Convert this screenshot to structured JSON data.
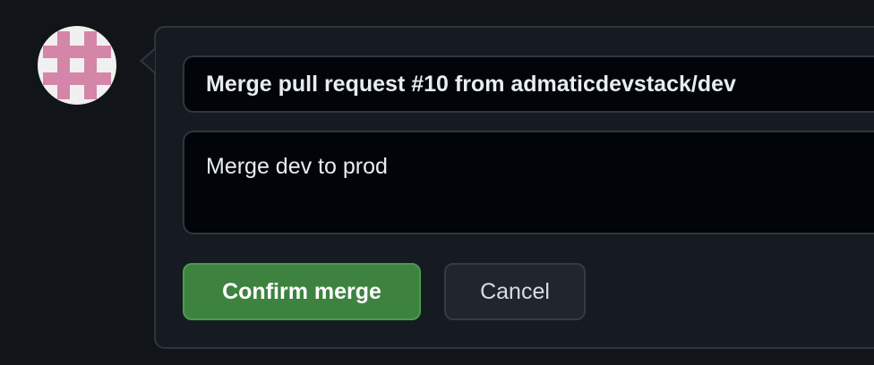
{
  "merge": {
    "title_value": "Merge pull request #10 from admaticdevstack/dev",
    "body_value": "Merge dev to prod",
    "confirm_label": "Confirm merge",
    "cancel_label": "Cancel"
  },
  "icons": {
    "avatar": "identicon-avatar"
  },
  "colors": {
    "confirm_button": "#3e8240",
    "avatar_pattern": "#d486a8",
    "background": "#111418"
  }
}
